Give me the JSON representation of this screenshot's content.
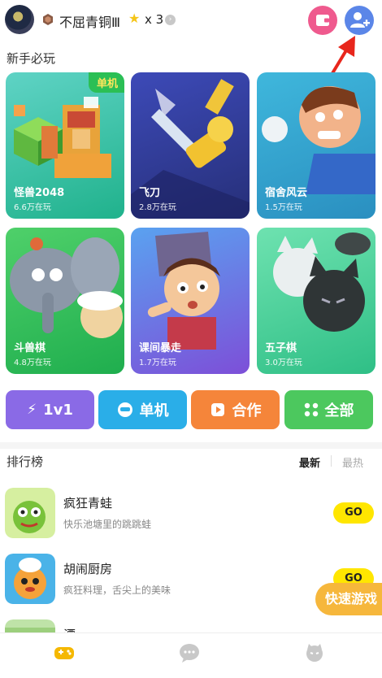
{
  "user": {
    "name": "不屈青铜Ⅲ",
    "star_count": "x 3"
  },
  "arrow_color": "#e8261c",
  "section_title": "新手必玩",
  "cards": [
    {
      "name": "怪兽2048",
      "players": "6.6万在玩",
      "badge": "单机"
    },
    {
      "name": "飞刀",
      "players": "2.8万在玩"
    },
    {
      "name": "宿舍风云",
      "players": "1.5万在玩"
    },
    {
      "name": "斗兽棋",
      "players": "4.8万在玩"
    },
    {
      "name": "课间暴走",
      "players": "1.7万在玩"
    },
    {
      "name": "五子棋",
      "players": "3.0万在玩"
    }
  ],
  "modes": [
    {
      "label": "1v1",
      "icon": "lightning-icon"
    },
    {
      "label": "单机",
      "icon": "robot-icon"
    },
    {
      "label": "合作",
      "icon": "play-icon"
    },
    {
      "label": "全部",
      "icon": "grid-icon"
    }
  ],
  "ranking": {
    "title": "排行榜",
    "tab_new": "最新",
    "tab_hot": "最热",
    "items": [
      {
        "title": "疯狂青蛙",
        "desc": "快乐池塘里的跳跳蛙",
        "action": "GO"
      },
      {
        "title": "胡闹厨房",
        "desc": "疯狂料理，舌尖上的美味",
        "action": "GO"
      },
      {
        "title": "漂",
        "desc": "",
        "action": ""
      }
    ]
  },
  "quick_game": "快速游戏"
}
